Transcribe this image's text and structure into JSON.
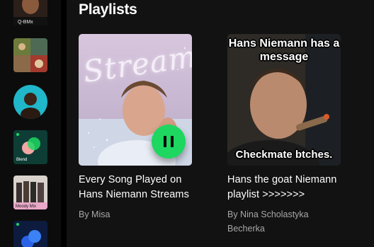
{
  "sidebar": {
    "items": [
      {
        "name": "sidebar-item-playlist-1",
        "label": "Q-BMx"
      },
      {
        "name": "sidebar-item-playlist-2",
        "label": ""
      },
      {
        "name": "sidebar-item-artist",
        "label": ""
      },
      {
        "name": "sidebar-item-blend",
        "label": "Blend"
      },
      {
        "name": "sidebar-item-moody-mix",
        "label": "Moody Mix"
      },
      {
        "name": "sidebar-item-playlist-6",
        "label": ""
      }
    ]
  },
  "main": {
    "section_title": "Playlists",
    "cards": [
      {
        "title": "Every Song Played on Hans Niemann Streams",
        "subtitle": "By Misa",
        "cover_text": "Stream",
        "playing": true
      },
      {
        "title": "Hans the goat Niemann playlist >>>>>>>",
        "subtitle": "By Nina Scholastyka Becherka",
        "cover_top_text": "Hans Niemann has a message",
        "cover_bottom_text": "Checkmate btches."
      }
    ]
  },
  "colors": {
    "background": "#121212",
    "sidebar": "#0c0c0c",
    "accent_green": "#1ed760",
    "text_primary": "#ffffff",
    "text_secondary": "#a7a7a7"
  },
  "icons": {
    "play_state": "pause-icon"
  }
}
